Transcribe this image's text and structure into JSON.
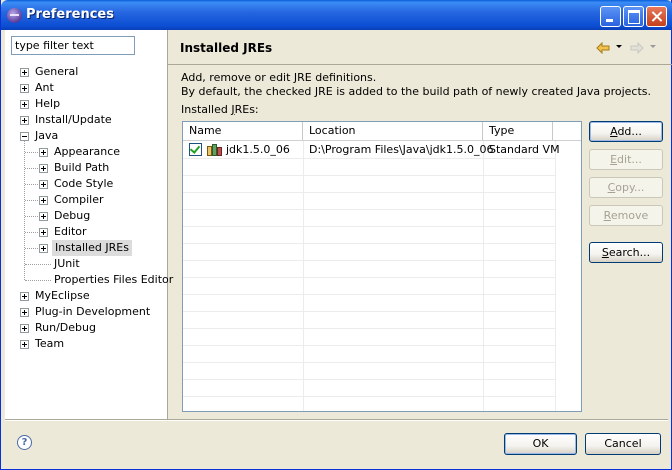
{
  "window": {
    "title": "Preferences"
  },
  "filter": {
    "placeholder": "type filter text"
  },
  "tree": [
    {
      "label": "General",
      "level": 0,
      "expander": "plus"
    },
    {
      "label": "Ant",
      "level": 0,
      "expander": "plus"
    },
    {
      "label": "Help",
      "level": 0,
      "expander": "plus"
    },
    {
      "label": "Install/Update",
      "level": 0,
      "expander": "plus"
    },
    {
      "label": "Java",
      "level": 0,
      "expander": "minus"
    },
    {
      "label": "Appearance",
      "level": 1,
      "expander": "plus"
    },
    {
      "label": "Build Path",
      "level": 1,
      "expander": "plus"
    },
    {
      "label": "Code Style",
      "level": 1,
      "expander": "plus"
    },
    {
      "label": "Compiler",
      "level": 1,
      "expander": "plus"
    },
    {
      "label": "Debug",
      "level": 1,
      "expander": "plus"
    },
    {
      "label": "Editor",
      "level": 1,
      "expander": "plus"
    },
    {
      "label": "Installed JREs",
      "level": 1,
      "expander": "plus",
      "selected": true
    },
    {
      "label": "JUnit",
      "level": 1,
      "expander": "none"
    },
    {
      "label": "Properties Files Editor",
      "level": 1,
      "expander": "none"
    },
    {
      "label": "MyEclipse",
      "level": 0,
      "expander": "plus"
    },
    {
      "label": "Plug-in Development",
      "level": 0,
      "expander": "plus"
    },
    {
      "label": "Run/Debug",
      "level": 0,
      "expander": "plus"
    },
    {
      "label": "Team",
      "level": 0,
      "expander": "plus"
    }
  ],
  "page": {
    "title": "Installed JREs",
    "description_line1": "Add, remove or edit JRE definitions.",
    "description_line2": "By default, the checked JRE is added to the build path of newly created Java projects.",
    "table_label": "Installed JREs:"
  },
  "table": {
    "columns": [
      "Name",
      "Location",
      "Type"
    ],
    "rows": [
      {
        "checked": true,
        "name": "jdk1.5.0_06",
        "location": "D:\\Program Files\\Java\\jdk1.5.0_06",
        "type": "Standard VM"
      }
    ]
  },
  "buttons": {
    "add": "Add...",
    "edit": "Edit...",
    "copy": "Copy...",
    "remove": "Remove",
    "search": "Search...",
    "ok": "OK",
    "cancel": "Cancel"
  },
  "help": {
    "glyph": "?"
  },
  "colors": {
    "title_bar": "#0a5fd9",
    "selection": "#dcdcdc",
    "window_bg": "#ece9d8"
  }
}
